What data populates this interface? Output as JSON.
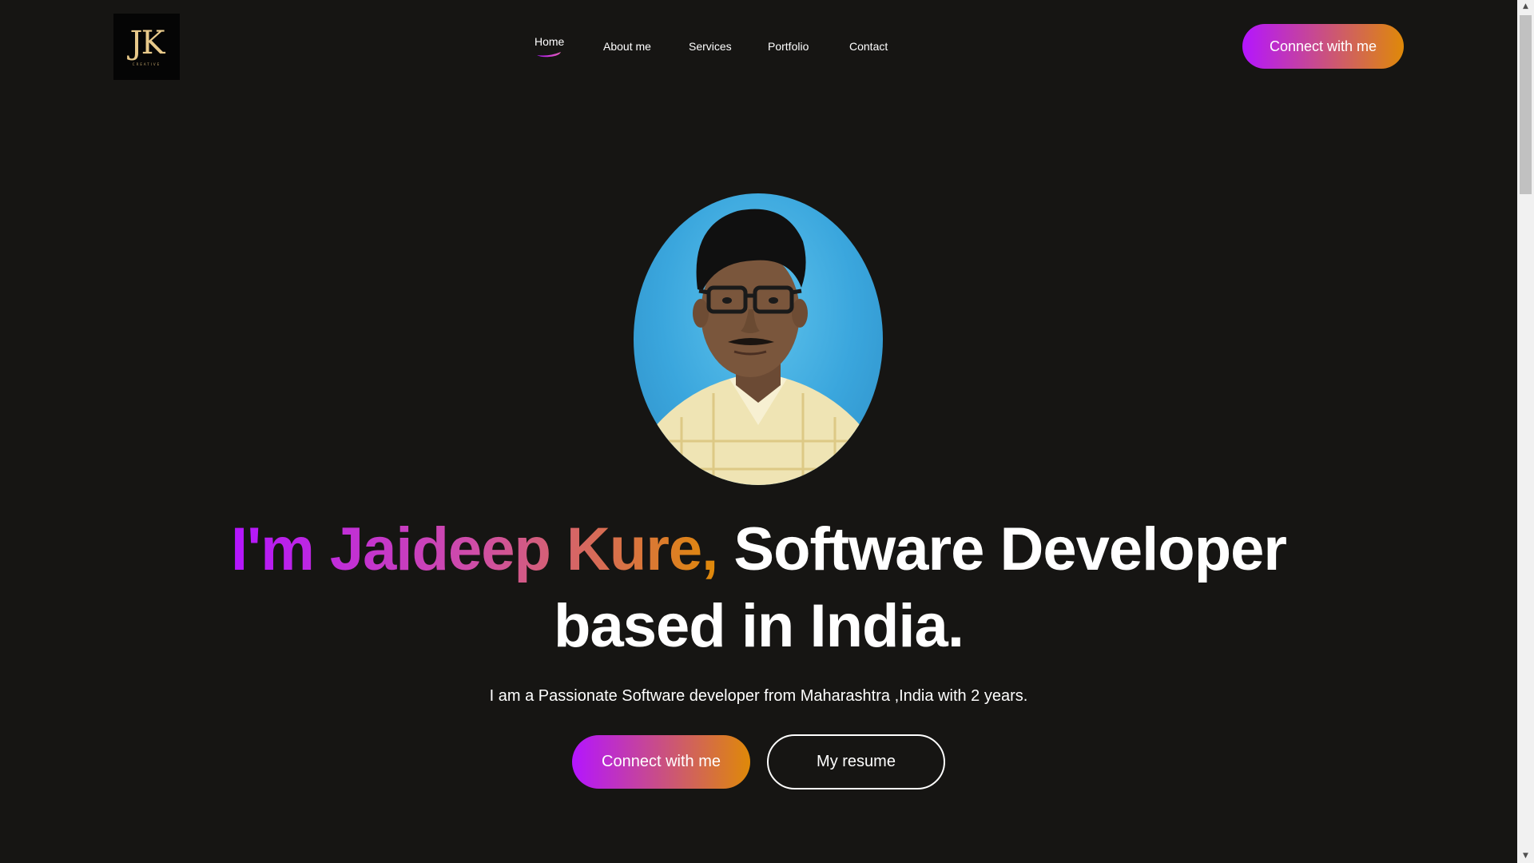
{
  "logo": {
    "mark": "JK",
    "sub": "CREATIVE"
  },
  "nav": {
    "items": [
      {
        "label": "Home",
        "active": true
      },
      {
        "label": "About me"
      },
      {
        "label": "Services"
      },
      {
        "label": "Portfolio"
      },
      {
        "label": "Contact"
      }
    ]
  },
  "header": {
    "connect_label": "Connect with me"
  },
  "hero": {
    "avatar_alt": "profile-photo",
    "headline_gradient": "I'm Jaideep Kure,",
    "headline_rest_line1": " Software Developer",
    "headline_line2": "based in India.",
    "tagline": "I am a Passionate Software developer from Maharashtra ,India with 2 years.",
    "connect_label": "Connect with me",
    "resume_label": "My resume"
  },
  "colors": {
    "background": "#161513",
    "gradient_start": "#b415ff",
    "gradient_end": "#df8908",
    "text": "#ffffff"
  }
}
